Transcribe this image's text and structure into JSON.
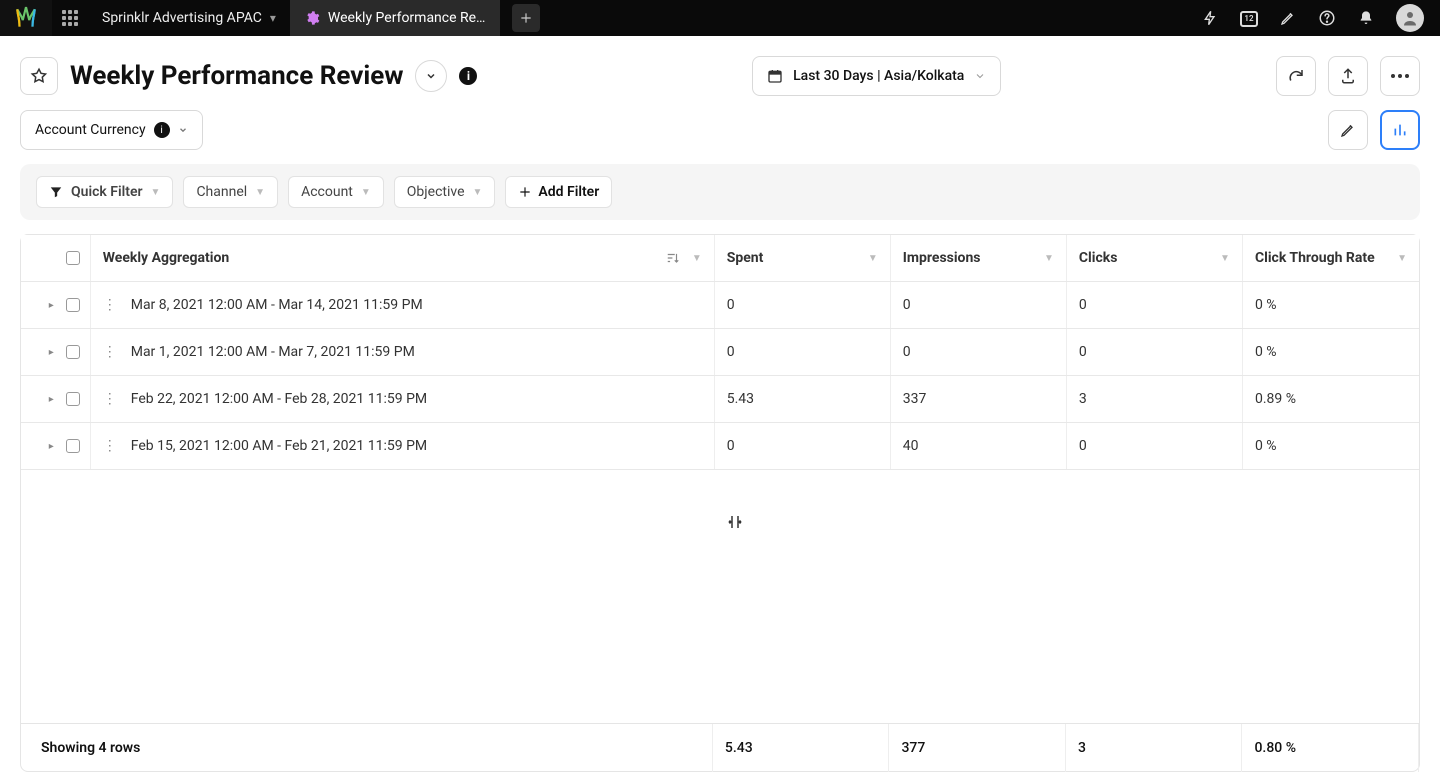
{
  "nav": {
    "workspace_tab": "Sprinklr Advertising APAC",
    "active_tab_label": "Weekly Performance Revie",
    "calendar_badge": "12"
  },
  "header": {
    "title": "Weekly Performance Review",
    "date_range_label": "Last 30 Days | Asia/Kolkata"
  },
  "subheader": {
    "currency_label": "Account Currency"
  },
  "filters": {
    "quick_filter": "Quick Filter",
    "channel": "Channel",
    "account": "Account",
    "objective": "Objective",
    "add_filter": "Add Filter"
  },
  "table": {
    "headers": {
      "aggregation": "Weekly Aggregation",
      "spent": "Spent",
      "impressions": "Impressions",
      "clicks": "Clicks",
      "ctr": "Click Through Rate"
    },
    "rows": [
      {
        "agg": "Mar 8, 2021 12:00 AM - Mar 14, 2021 11:59 PM",
        "spent": "0",
        "impressions": "0",
        "clicks": "0",
        "ctr": "0 %"
      },
      {
        "agg": "Mar 1, 2021 12:00 AM - Mar 7, 2021 11:59 PM",
        "spent": "0",
        "impressions": "0",
        "clicks": "0",
        "ctr": "0 %"
      },
      {
        "agg": "Feb 22, 2021 12:00 AM - Feb 28, 2021 11:59 PM",
        "spent": "5.43",
        "impressions": "337",
        "clicks": "3",
        "ctr": "0.89 %"
      },
      {
        "agg": "Feb 15, 2021 12:00 AM - Feb 21, 2021 11:59 PM",
        "spent": "0",
        "impressions": "40",
        "clicks": "0",
        "ctr": "0 %"
      }
    ],
    "footer_label": "Showing 4 rows",
    "totals": {
      "spent": "5.43",
      "impressions": "377",
      "clicks": "3",
      "ctr": "0.80 %"
    }
  }
}
